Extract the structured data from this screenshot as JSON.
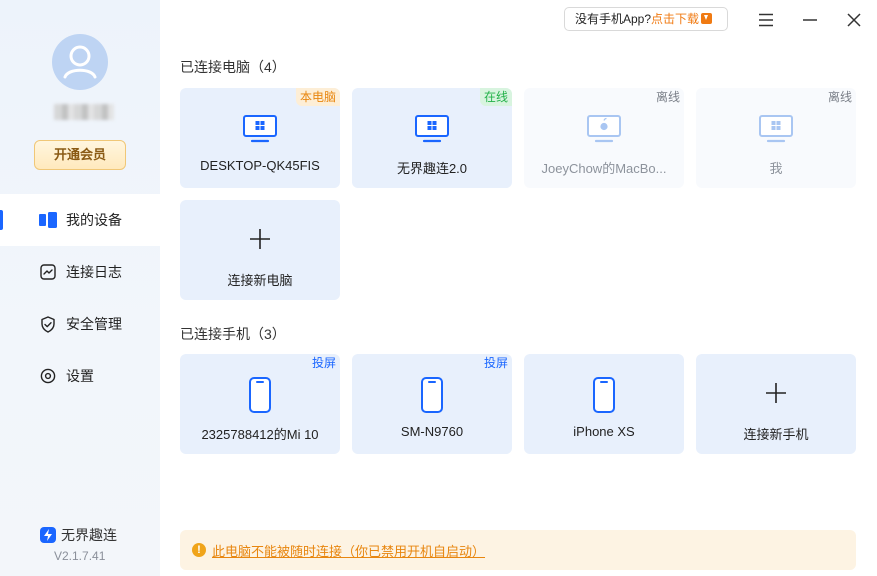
{
  "sidebar": {
    "vip_label": "开通会员",
    "nav": [
      {
        "label": "我的设备",
        "icon": "devices-icon",
        "active": true
      },
      {
        "label": "连接日志",
        "icon": "log-icon",
        "active": false
      },
      {
        "label": "安全管理",
        "icon": "shield-icon",
        "active": false
      },
      {
        "label": "设置",
        "icon": "settings-icon",
        "active": false
      }
    ],
    "brand": "无界趣连",
    "version": "V2.1.7.41"
  },
  "topbar": {
    "promo_text": "没有手机App?",
    "promo_link": "点击下载"
  },
  "computers": {
    "title": "已连接电脑（4）",
    "items": [
      {
        "name": "DESKTOP-QK45FIS",
        "tag": "本电脑",
        "status": "self"
      },
      {
        "name": "无界趣连2.0",
        "tag": "在线",
        "status": "online"
      },
      {
        "name": "JoeyChow的MacBo...",
        "tag": "离线",
        "status": "offline"
      },
      {
        "name": "我",
        "tag": "离线",
        "status": "offline"
      }
    ],
    "add_label": "连接新电脑"
  },
  "phones": {
    "title": "已连接手机（3）",
    "items": [
      {
        "name": "2325788412的Mi 10",
        "tag": "投屏"
      },
      {
        "name": "SM-N9760",
        "tag": "投屏"
      },
      {
        "name": "iPhone XS",
        "tag": ""
      }
    ],
    "add_label": "连接新手机"
  },
  "warning": {
    "text": "此电脑不能被随时连接（你已禁用开机自启动）"
  },
  "colors": {
    "accent": "#1a66ff",
    "card_bg": "#e8f0fc",
    "warning": "#e8860f",
    "online": "#24b24a"
  }
}
